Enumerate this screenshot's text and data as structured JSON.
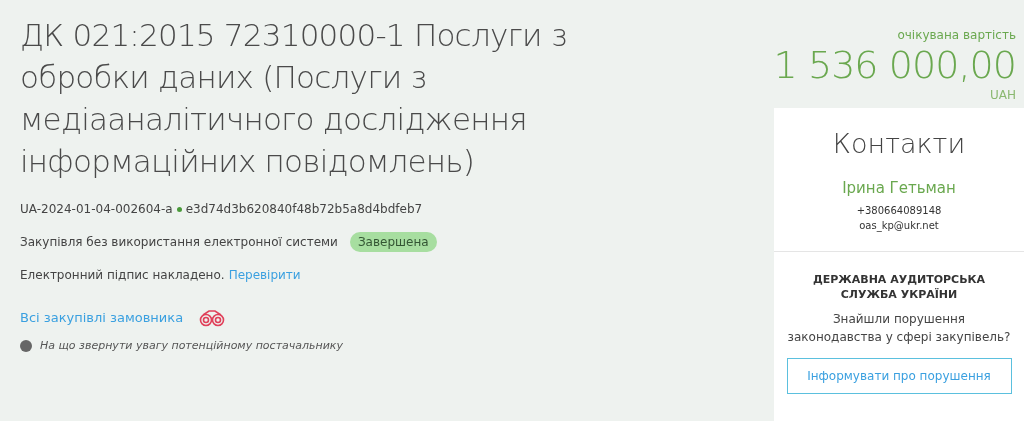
{
  "title": "ДК 021:2015 72310000-1 Послуги з обробки даних (Послуги з медіааналітичного дослідження інформаційних повідомлень)",
  "tender_id": "UA-2024-01-04-002604-a",
  "hash": "e3d74d3b620840f48b72b5a8d4bdfeb7",
  "procedure": "Закупівля без використання електронної системи",
  "status": "Завершена",
  "signature": {
    "text": "Електронний підпис накладено.",
    "link": "Перевірити"
  },
  "buyer_link": "Всі закупівлі замовника",
  "hint": "На що звернути увагу потенційному постачальнику",
  "value": {
    "label": "очікувана вартість",
    "amount": "1 536 000,00",
    "currency": "UAH"
  },
  "contacts": {
    "title": "Контакти",
    "name": "Ірина Гетьман",
    "phone": "+380664089148",
    "email": "oas_kp@ukr.net"
  },
  "audit": {
    "title": "ДЕРЖАВНА АУДИТОРСЬКА СЛУЖБА УКРАЇНИ",
    "question": "Знайшли порушення законодавства у сфері закупівель?",
    "button": "Інформувати про порушення"
  }
}
